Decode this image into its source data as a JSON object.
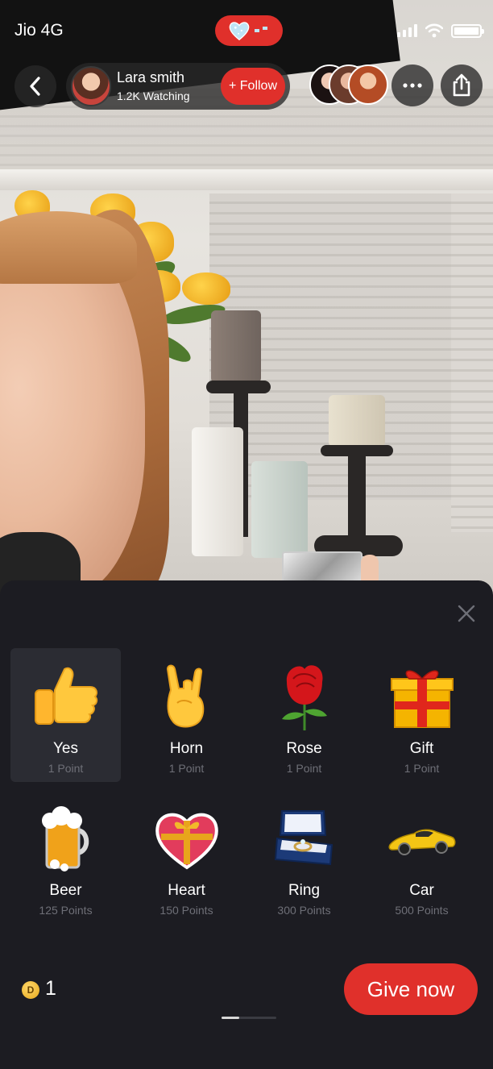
{
  "status_bar": {
    "carrier": "Jio 4G",
    "live_icon": "heart-live-icon",
    "signal_icon": "signal-icon",
    "wifi_icon": "wifi-icon",
    "battery_icon": "battery-icon"
  },
  "header": {
    "back_icon": "chevron-left-icon",
    "host": {
      "name": "Lara smith",
      "watching": "1.2K Watching",
      "follow_label": "+ Follow"
    },
    "viewer_avatars": [
      "viewer-1",
      "viewer-2",
      "viewer-3"
    ],
    "more_icon": "more-icon",
    "share_icon": "share-icon"
  },
  "gift_sheet": {
    "close_icon": "close-icon",
    "gifts": [
      {
        "name": "Yes",
        "points": "1 Point",
        "icon": "thumbs-up-icon",
        "selected": true
      },
      {
        "name": "Horn",
        "points": "1 Point",
        "icon": "horns-hand-icon",
        "selected": false
      },
      {
        "name": "Rose",
        "points": "1 Point",
        "icon": "rose-icon",
        "selected": false
      },
      {
        "name": "Gift",
        "points": "1 Point",
        "icon": "gift-box-icon",
        "selected": false
      },
      {
        "name": "Beer",
        "points": "125 Points",
        "icon": "beer-mug-icon",
        "selected": false
      },
      {
        "name": "Heart",
        "points": "150 Points",
        "icon": "heart-box-icon",
        "selected": false
      },
      {
        "name": "Ring",
        "points": "300 Points",
        "icon": "ring-box-icon",
        "selected": false
      },
      {
        "name": "Car",
        "points": "500 Points",
        "icon": "sports-car-icon",
        "selected": false
      }
    ],
    "pager": {
      "page": 1,
      "pages": 3
    },
    "balance": {
      "coin_label": "D",
      "value": "1"
    },
    "give_label": "Give now"
  },
  "colors": {
    "accent": "#e0302b",
    "sheet_bg": "#1c1c22",
    "selected_bg": "#2b2c33",
    "muted_text": "#6e6f77"
  }
}
